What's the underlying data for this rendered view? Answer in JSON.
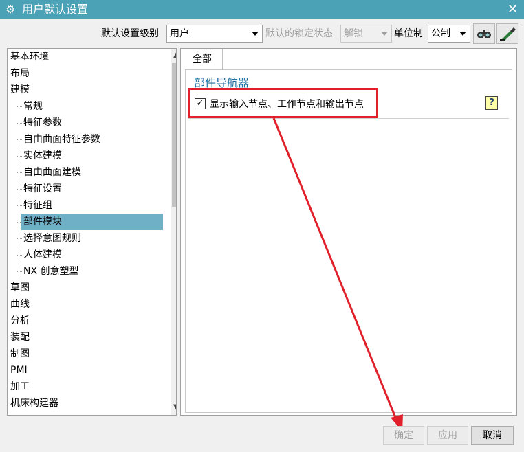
{
  "window": {
    "title": "用户默认设置",
    "close_glyph": "✕",
    "gear_glyph": "⚙"
  },
  "toolbar": {
    "level_label": "默认设置级别",
    "level_value": "用户",
    "lock_label": "默认的锁定状态",
    "lock_value": "解锁",
    "unit_label": "单位制",
    "unit_value": "公制"
  },
  "tree": {
    "items": [
      {
        "label": "基本环境",
        "level": 0,
        "selected": false
      },
      {
        "label": "布局",
        "level": 0,
        "selected": false
      },
      {
        "label": "建模",
        "level": 0,
        "selected": false
      },
      {
        "label": "常规",
        "level": 1,
        "selected": false
      },
      {
        "label": "特征参数",
        "level": 1,
        "selected": false
      },
      {
        "label": "自由曲面特征参数",
        "level": 1,
        "selected": false
      },
      {
        "label": "实体建模",
        "level": 1,
        "selected": false
      },
      {
        "label": "自由曲面建模",
        "level": 1,
        "selected": false
      },
      {
        "label": "特征设置",
        "level": 1,
        "selected": false
      },
      {
        "label": "特征组",
        "level": 1,
        "selected": false
      },
      {
        "label": "部件模块",
        "level": 1,
        "selected": true
      },
      {
        "label": "选择意图规则",
        "level": 1,
        "selected": false
      },
      {
        "label": "人体建模",
        "level": 1,
        "selected": false
      },
      {
        "label": "NX 创意塑型",
        "level": 1,
        "selected": false
      },
      {
        "label": "草图",
        "level": 0,
        "selected": false
      },
      {
        "label": "曲线",
        "level": 0,
        "selected": false
      },
      {
        "label": "分析",
        "level": 0,
        "selected": false
      },
      {
        "label": "装配",
        "level": 0,
        "selected": false
      },
      {
        "label": "制图",
        "level": 0,
        "selected": false
      },
      {
        "label": "PMI",
        "level": 0,
        "selected": false
      },
      {
        "label": "加工",
        "level": 0,
        "selected": false
      },
      {
        "label": "机床构建器",
        "level": 0,
        "selected": false
      }
    ]
  },
  "content": {
    "tab_label": "全部",
    "group_title": "部件导航器",
    "checkbox_label": "显示输入节点、工作节点和输出节点",
    "checkbox_checked": true,
    "help_glyph": "?"
  },
  "buttons": {
    "ok": "确定",
    "apply": "应用",
    "cancel": "取消"
  },
  "colors": {
    "titlebar": "#4ba1b5",
    "selection": "#6fb0c6",
    "annotation": "#e0202a",
    "group_title": "#1f6fa0"
  }
}
